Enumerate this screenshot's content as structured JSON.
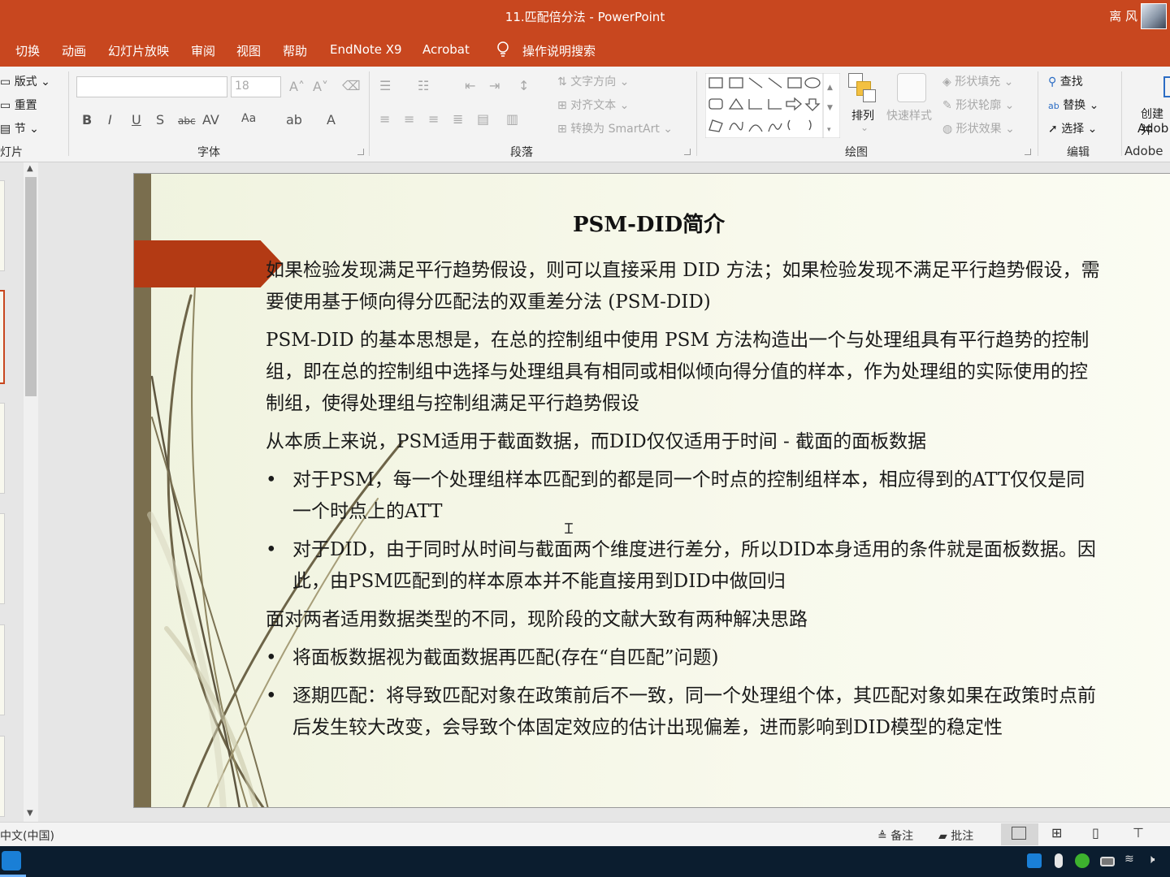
{
  "titlebar": {
    "title": "11.匹配倍分法  -  PowerPoint",
    "user": "离 风"
  },
  "tabs": [
    "切换",
    "动画",
    "幻灯片放映",
    "审阅",
    "视图",
    "帮助",
    "EndNote X9",
    "Acrobat"
  ],
  "tell_me": "操作说明搜索",
  "ribbon": {
    "slides_group": {
      "layout": "版式",
      "reset": "重置",
      "section": "节",
      "label": "灯片"
    },
    "font_group": {
      "font_size": "18",
      "label": "字体"
    },
    "paragraph_group": {
      "text_direction": "文字方向",
      "align_text": "对齐文本",
      "convert_smartart": "转换为 SmartArt",
      "label": "段落"
    },
    "drawing_group": {
      "arrange": "排列",
      "quick_styles": "快速样式",
      "shape_fill": "形状填充",
      "shape_outline": "形状轮廓",
      "shape_effects": "形状效果",
      "label": "绘图"
    },
    "editing_group": {
      "find": "查找",
      "replace": "替换",
      "select": "选择",
      "label": "编辑"
    },
    "adobe_group": {
      "create": "创建并",
      "adobe": "Adob",
      "label": "Adobe"
    }
  },
  "slide": {
    "title": "PSM-DID简介",
    "para1": "如果检验发现满足平行趋势假设，则可以直接采用 DID 方法；如果检验发现不满足平行趋势假设，需要使用基于倾向得分匹配法的双重差分法 (PSM-DID)",
    "para2": "PSM-DID 的基本思想是，在总的控制组中使用 PSM 方法构造出一个与处理组具有平行趋势的控制组，即在总的控制组中选择与处理组具有相同或相似倾向得分值的样本，作为处理组的实际使用的控制组，使得处理组与控制组满足平行趋势假设",
    "para3": "从本质上来说，PSM适用于截面数据，而DID仅仅适用于时间 - 截面的面板数据",
    "bullet1": "对于PSM，每一个处理组样本匹配到的都是同一个时点的控制组样本，相应得到的ATT仅仅是同一个时点上的ATT",
    "bullet2": "对于DID，由于同时从时间与截面两个维度进行差分，所以DID本身适用的条件就是面板数据。因此，由PSM匹配到的样本原本并不能直接用到DID中做回归",
    "para4": "面对两者适用数据类型的不同，现阶段的文献大致有两种解决思路",
    "bullet3": "将面板数据视为截面数据再匹配(存在“自匹配”问题)",
    "bullet4": "逐期匹配：将导致匹配对象在政策前后不一致，同一个处理组个体，其匹配对象如果在政策时点前后发生较大改变，会导致个体固定效应的估计出现偏差，进而影响到DID模型的稳定性"
  },
  "statusbar": {
    "language": "中文(中国)",
    "notes": "备注",
    "comments": "批注"
  },
  "colors": {
    "accent": "#c8471f",
    "banner": "#b33a14",
    "leftbar": "#7a6e4e",
    "taskbar": "#0b1d2f"
  }
}
